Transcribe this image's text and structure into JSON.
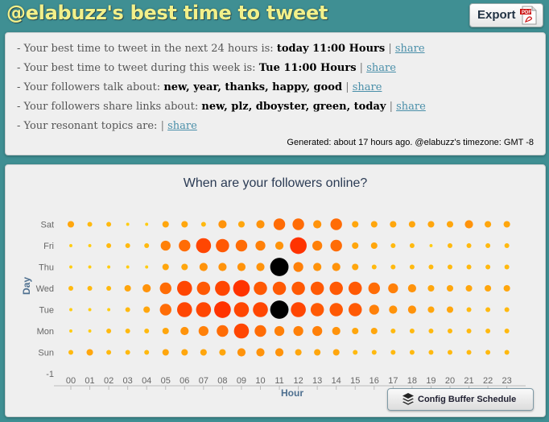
{
  "header": {
    "title": "@elabuzz's best time to tweet",
    "export_label": "Export"
  },
  "info": {
    "line1": {
      "prefix": "- Your best time to tweet in the next 24 hours is:",
      "value": "today 11:00 Hours"
    },
    "line2": {
      "prefix": "- Your best time to tweet during this week is:",
      "value": "Tue 11:00 Hours"
    },
    "line3": {
      "prefix": "- Your followers talk about:",
      "value": "new, year, thanks, happy, good"
    },
    "line4": {
      "prefix": "- Your followers share links about:",
      "value": "new, plz, dboyster, green, today"
    },
    "line5": {
      "prefix": "- Your resonant topics are:",
      "value": ""
    },
    "separator": "|",
    "share_label": "share",
    "generated": "Generated: about 17 hours ago. @elabuzz's timezone: GMT -8"
  },
  "config_button_label": "Config Buffer Schedule",
  "colors": {
    "background": "#3f8f93",
    "title": "#f2f08a",
    "link": "#4a8fa9",
    "bubble_low": "#ffcc11",
    "bubble_high": "#ff3300",
    "bubble_max": "#000000"
  },
  "chart_data": {
    "type": "scatter",
    "title": "When are your followers online?",
    "xlabel": "Hour",
    "ylabel": "Day",
    "x_ticks": [
      "00",
      "01",
      "02",
      "03",
      "04",
      "05",
      "06",
      "07",
      "08",
      "09",
      "10",
      "11",
      "12",
      "13",
      "14",
      "15",
      "16",
      "17",
      "18",
      "19",
      "20",
      "21",
      "22",
      "23"
    ],
    "y_ticks": [
      "-1",
      "Sun",
      "Mon",
      "Tue",
      "Wed",
      "Thu",
      "Fri",
      "Sat"
    ],
    "rows": [
      {
        "day": "Sat",
        "values": [
          3,
          2,
          2,
          1,
          1,
          3,
          3,
          2,
          4,
          3,
          4,
          6,
          6,
          4,
          6,
          3,
          3,
          3,
          3,
          3,
          3,
          4,
          3,
          3
        ]
      },
      {
        "day": "Fri",
        "values": [
          1,
          1,
          2,
          2,
          2,
          5,
          6,
          8,
          7,
          6,
          5,
          4,
          9,
          5,
          6,
          3,
          3,
          2,
          2,
          1,
          2,
          2,
          2,
          2
        ]
      },
      {
        "day": "Thu",
        "values": [
          1,
          1,
          1,
          1,
          1,
          3,
          3,
          4,
          4,
          4,
          4,
          10,
          5,
          4,
          4,
          3,
          2,
          2,
          2,
          2,
          2,
          2,
          2,
          2
        ]
      },
      {
        "day": "Wed",
        "values": [
          2,
          2,
          2,
          3,
          4,
          6,
          8,
          7,
          8,
          9,
          7,
          7,
          7,
          7,
          7,
          7,
          6,
          5,
          4,
          3,
          3,
          3,
          3,
          3
        ]
      },
      {
        "day": "Tue",
        "values": [
          1,
          1,
          1,
          2,
          3,
          6,
          8,
          8,
          9,
          8,
          8,
          10,
          8,
          7,
          7,
          7,
          5,
          4,
          4,
          3,
          3,
          2,
          2,
          2
        ]
      },
      {
        "day": "Mon",
        "values": [
          1,
          1,
          2,
          2,
          2,
          3,
          4,
          5,
          6,
          8,
          6,
          5,
          5,
          5,
          4,
          3,
          3,
          2,
          2,
          2,
          2,
          2,
          2,
          2
        ]
      },
      {
        "day": "Sun",
        "values": [
          2,
          3,
          2,
          2,
          2,
          3,
          3,
          3,
          3,
          4,
          4,
          4,
          3,
          3,
          3,
          2,
          2,
          2,
          2,
          2,
          2,
          2,
          2,
          2
        ]
      }
    ],
    "grid": false,
    "legend": "none"
  }
}
